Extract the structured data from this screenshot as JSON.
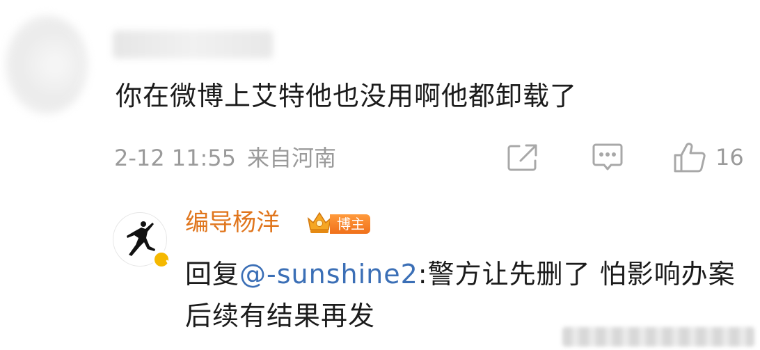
{
  "comment": {
    "text": "你在微博上艾特他也没用啊他都卸载了",
    "time": "2-12 11:55",
    "location": "来自河南",
    "like_count": "16",
    "share_icon": "share-icon",
    "reply_icon": "comment-icon",
    "like_icon": "thumbs-up-icon"
  },
  "reply": {
    "author": "编导杨洋",
    "badge": "博主",
    "prefix": "回复",
    "mention": "@-sunshine2",
    "body": ":警方让先删了 怕影响办案 后续有结果再发",
    "avatar_icon": "jumpman-logo",
    "verified_icon": "verified-badge-icon",
    "crown_icon": "crown-icon"
  },
  "colors": {
    "author": "#e0751c",
    "mention": "#3b6fb6",
    "meta": "#9a9a9a",
    "badge": "#f0701a",
    "verified": "#f5b800"
  }
}
